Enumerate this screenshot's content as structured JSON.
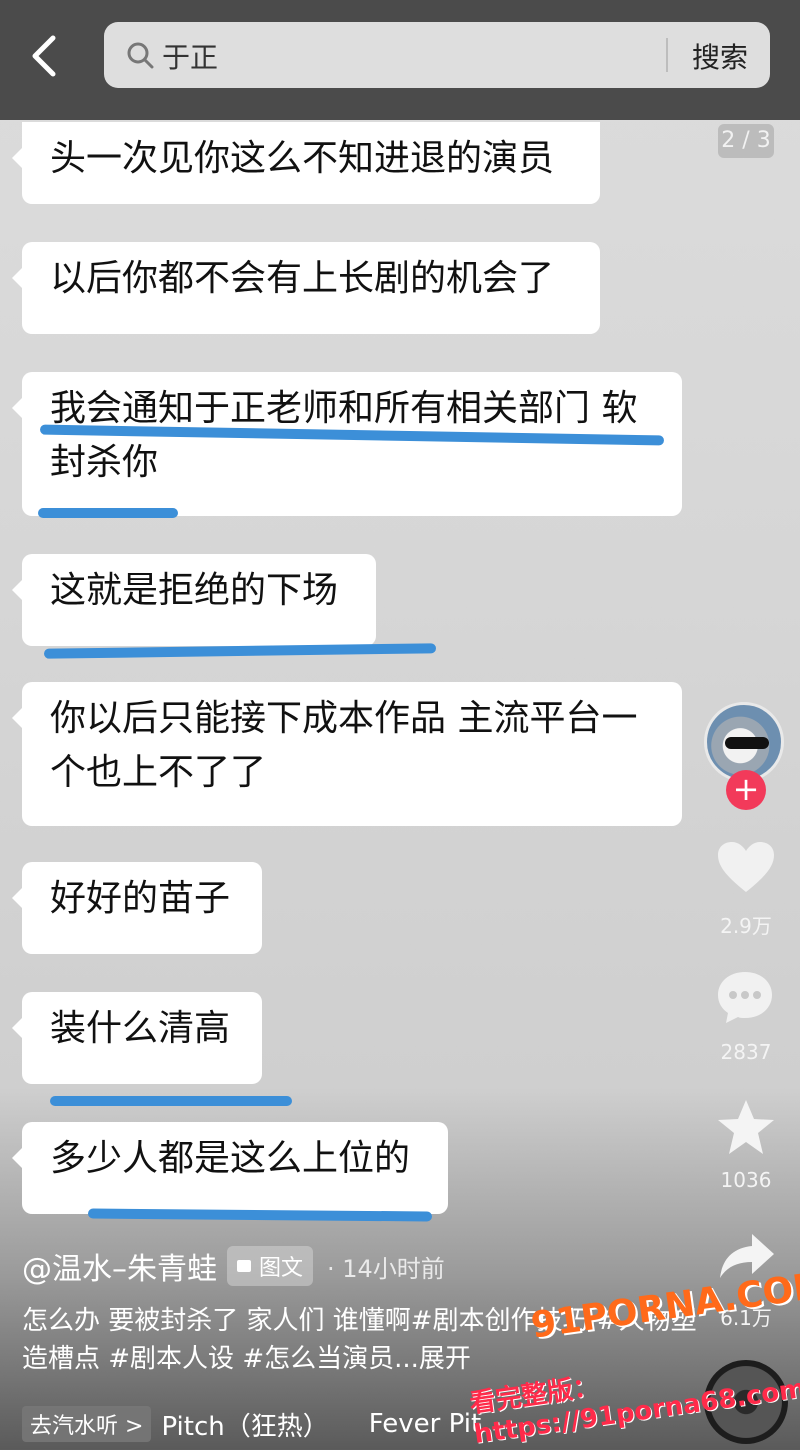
{
  "search": {
    "query": "于正",
    "button": "搜索"
  },
  "page_indicator": "2 / 3",
  "messages": [
    "头一次见你这么不知进退的演员",
    "以后你都不会有上长剧的机会了",
    "我会通知于正老师和所有相关部门 软封杀你",
    "这就是拒绝的下场",
    "你以后只能接下成本作品 主流平台一个也上不了了",
    "好好的苗子",
    "装什么清高",
    "多少人都是这么上位的"
  ],
  "sidebar": {
    "likes": "2.9万",
    "comments": "2837",
    "favorites": "1036",
    "shares": "6.1万"
  },
  "post": {
    "author": "@温水–朱青蛙",
    "type_tag": "图文",
    "time": "· 14小时前",
    "caption": "怎么办 要被封杀了 家人们 谁懂啊#剧本创作技巧 #人物塑造槽点 #剧本人设 #怎么当演员...展开"
  },
  "music": {
    "chip": "去汽水听 >",
    "title1": "Pitch（狂热）",
    "title2": "Fever Pit"
  },
  "watermark": {
    "brand": "91PORNA.COM",
    "url": "看完整版：https://91porna68.com"
  },
  "colors": {
    "underline": "#3c8fd8",
    "follow": "#f23a5a",
    "topbar": "#4b4b4b"
  }
}
